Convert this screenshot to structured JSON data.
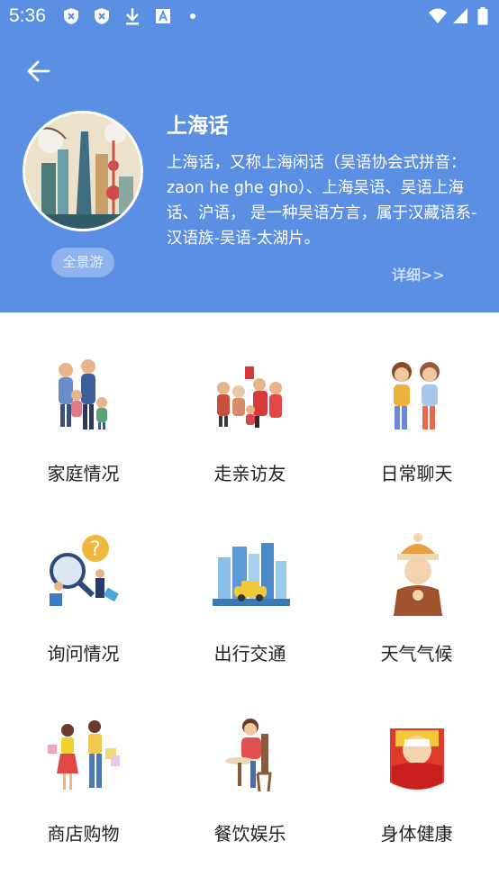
{
  "status_bar": {
    "time": "5:36"
  },
  "city": {
    "title": "上海话",
    "description": "上海话，又称上海闲话（吴语协会式拼音：zaon he ghe gho）、上海吴语、吴语上海话、沪语， 是一种吴语方言，属于汉藏语系-汉语族-吴语-太湖片。",
    "pano_label": "全景游",
    "more_label": "详细>>"
  },
  "colors": {
    "header_bg": "#5a8fe3",
    "accent_text": "#c9dcff"
  },
  "categories": [
    {
      "label": "家庭情况",
      "icon": "family-illustration"
    },
    {
      "label": "走亲访友",
      "icon": "visiting-relatives-illustration"
    },
    {
      "label": "日常聊天",
      "icon": "daily-chat-illustration"
    },
    {
      "label": "询问情况",
      "icon": "magnifier-question-illustration"
    },
    {
      "label": "出行交通",
      "icon": "city-taxi-illustration"
    },
    {
      "label": "天气气候",
      "icon": "cold-weather-illustration"
    },
    {
      "label": "商店购物",
      "icon": "shopping-couple-illustration"
    },
    {
      "label": "餐饮娱乐",
      "icon": "dining-illustration"
    },
    {
      "label": "身体健康",
      "icon": "sick-in-bed-illustration"
    }
  ]
}
